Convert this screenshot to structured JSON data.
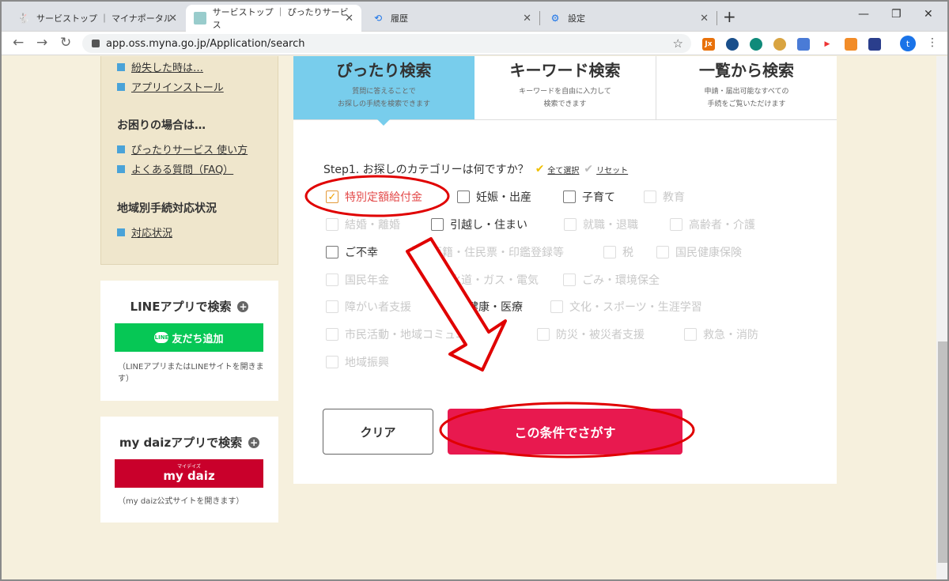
{
  "browser": {
    "tabs": [
      {
        "label": "サービストップ ｜ マイナポータル",
        "icon": "rabbit-icon"
      },
      {
        "label": "サービストップ ｜ ぴったりサービス",
        "icon": "site-icon"
      },
      {
        "label": "履歴",
        "icon": "history-icon"
      },
      {
        "label": "設定",
        "icon": "gear-icon"
      }
    ],
    "url": "app.oss.myna.go.jp/Application/search",
    "profile_initial": "t",
    "ext_label_jx": "Jx"
  },
  "sidebar": {
    "links_top": [
      "紛失した時は…",
      "アプリインストール"
    ],
    "help_heading": "お困りの場合は…",
    "help_links": [
      "ぴったりサービス 使い方",
      "よくある質問（FAQ）"
    ],
    "region_heading": "地域別手続対応状況",
    "region_links": [
      "対応状況"
    ],
    "line_card": {
      "title": "LINEアプリで検索",
      "button": "友だち追加",
      "icon_label": "LINE",
      "note": "（LINEアプリまたはLINEサイトを開きます）"
    },
    "daiz_card": {
      "title": "my daizアプリで検索",
      "ruby": "マイデイズ",
      "button": "my daiz",
      "note": "（my daiz公式サイトを開きます）"
    }
  },
  "search_tabs": [
    {
      "title": "ぴったり検索",
      "desc1": "質問に答えることで",
      "desc2": "お探しの手続を検索できます"
    },
    {
      "title": "キーワード検索",
      "desc1": "キーワードを自由に入力して",
      "desc2": "検索できます"
    },
    {
      "title": "一覧から検索",
      "desc1": "申請・届出可能なすべての",
      "desc2": "手続をご覧いただけます"
    }
  ],
  "step": {
    "label": "Step1. お探しのカテゴリーは何ですか？",
    "select_all": "全て選択",
    "reset": "リセット"
  },
  "categories": [
    {
      "label": "特別定額給付金",
      "checked": true,
      "enabled": true
    },
    {
      "label": "妊娠・出産",
      "checked": false,
      "enabled": true
    },
    {
      "label": "子育て",
      "checked": false,
      "enabled": true
    },
    {
      "label": "教育",
      "checked": false,
      "enabled": false
    },
    {
      "label": "結婚・離婚",
      "checked": false,
      "enabled": false
    },
    {
      "label": "引越し・住まい",
      "checked": false,
      "enabled": true
    },
    {
      "label": "就職・退職",
      "checked": false,
      "enabled": false
    },
    {
      "label": "高齢者・介護",
      "checked": false,
      "enabled": false
    },
    {
      "label": "ご不幸",
      "checked": false,
      "enabled": true
    },
    {
      "label": "戸籍・住民票・印鑑登録等",
      "checked": false,
      "enabled": false
    },
    {
      "label": "税",
      "checked": false,
      "enabled": false
    },
    {
      "label": "国民健康保険",
      "checked": false,
      "enabled": false
    },
    {
      "label": "国民年金",
      "checked": false,
      "enabled": false
    },
    {
      "label": "水道・ガス・電気",
      "checked": false,
      "enabled": false
    },
    {
      "label": "ごみ・環境保全",
      "checked": false,
      "enabled": false
    },
    {
      "label": "障がい者支援",
      "checked": false,
      "enabled": false
    },
    {
      "label": "健康・医療",
      "checked": false,
      "enabled": true
    },
    {
      "label": "文化・スポーツ・生涯学習",
      "checked": false,
      "enabled": false
    },
    {
      "label": "市民活動・地域コミュニティ",
      "checked": false,
      "enabled": false
    },
    {
      "label": "防災・被災者支援",
      "checked": false,
      "enabled": false
    },
    {
      "label": "救急・消防",
      "checked": false,
      "enabled": false
    },
    {
      "label": "地域振興",
      "checked": false,
      "enabled": false
    }
  ],
  "buttons": {
    "clear": "クリア",
    "search": "この条件でさがす"
  },
  "colors": {
    "accent_tab": "#78cdec",
    "search_button": "#e8194f",
    "line_green": "#06c755",
    "daiz_red": "#c9002b",
    "annotation_red": "#e00000"
  }
}
